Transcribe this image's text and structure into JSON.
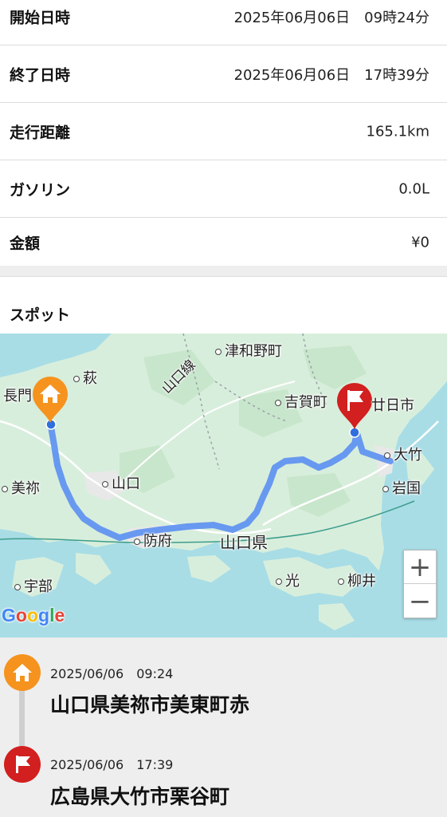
{
  "details": {
    "start": {
      "label": "開始日時",
      "value": "2025年06月06日　09時24分"
    },
    "end": {
      "label": "終了日時",
      "value": "2025年06月06日　17時39分"
    },
    "distance": {
      "label": "走行距離",
      "value": "165.1km"
    },
    "gasoline": {
      "label": "ガソリン",
      "value": "0.0L"
    },
    "amount": {
      "label": "金額",
      "value": "¥0"
    }
  },
  "spot": {
    "title": "スポット"
  },
  "map": {
    "labels": {
      "tsuwano": "津和野町",
      "hagi": "萩",
      "nagato": "長門",
      "yamaguchi_line": "山口線",
      "yoshika": "吉賀町",
      "hatsukaichi": "廿日市",
      "otake": "大竹",
      "iwakuni": "岩国",
      "mine": "美祢",
      "yamaguchi": "山口",
      "hofu": "防府",
      "yamaguchi_pref": "山口県",
      "hikari": "光",
      "yanai": "柳井",
      "ube": "宇部"
    },
    "zoom_in": "+",
    "zoom_out": "−",
    "google_logo": [
      "G",
      "o",
      "o",
      "g",
      "l",
      "e"
    ],
    "colors": {
      "route": "#5b8ff2",
      "start_marker": "#f5931e",
      "end_marker": "#d21f1f",
      "water": "#a8dde6",
      "land": "#d7eedb"
    },
    "icons": {
      "start": "home-icon",
      "end": "flag-icon"
    }
  },
  "timeline": {
    "items": [
      {
        "date": "2025/06/06　09:24",
        "address": "山口県美祢市美東町赤",
        "icon": "home-icon",
        "color": "#f5931e"
      },
      {
        "date": "2025/06/06　17:39",
        "address": "広島県大竹市栗谷町",
        "icon": "flag-icon",
        "color": "#d21f1f"
      }
    ]
  }
}
